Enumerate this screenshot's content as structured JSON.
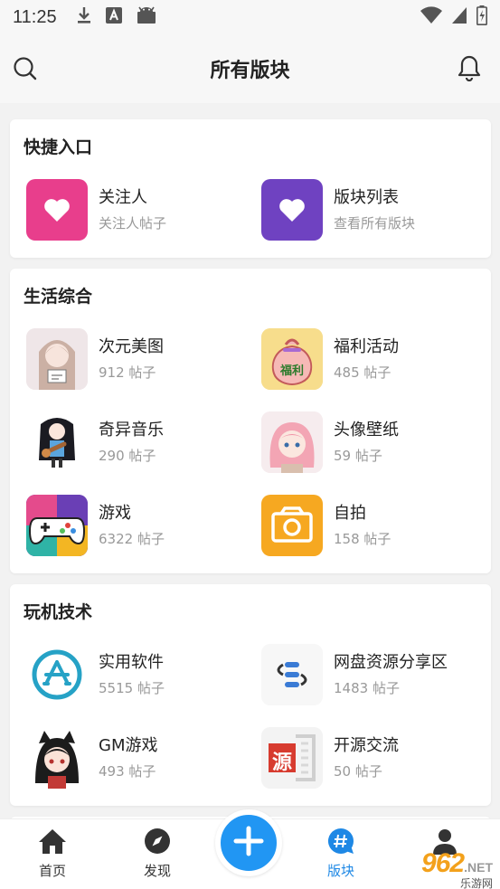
{
  "status_bar": {
    "time": "11:25"
  },
  "header": {
    "title": "所有版块"
  },
  "colors": {
    "accent": "#2196f3",
    "active_tab": "#1e88e5",
    "pink_tile": "#e83e8c",
    "purple_tile": "#6f42c1",
    "orange_tile": "#f6a821"
  },
  "sections": [
    {
      "title": "快捷入口",
      "items": [
        {
          "name": "关注人",
          "sub": "关注人帖子",
          "icon": "heart-icon"
        },
        {
          "name": "版块列表",
          "sub": "查看所有版块",
          "icon": "heart-icon"
        }
      ]
    },
    {
      "title": "生活综合",
      "items": [
        {
          "name": "次元美图",
          "sub": "912 帖子",
          "icon": "anime-girl-thumbnail"
        },
        {
          "name": "福利活动",
          "sub": "485 帖子",
          "icon": "money-bag-icon",
          "badge": "福利"
        },
        {
          "name": "奇异音乐",
          "sub": "290 帖子",
          "icon": "anime-guitar-thumbnail"
        },
        {
          "name": "头像壁纸",
          "sub": "59 帖子",
          "icon": "pink-hair-avatar-thumbnail"
        },
        {
          "name": "游戏",
          "sub": "6322 帖子",
          "icon": "gamepad-icon"
        },
        {
          "name": "自拍",
          "sub": "158 帖子",
          "icon": "camera-icon"
        }
      ]
    },
    {
      "title": "玩机技术",
      "items": [
        {
          "name": "实用软件",
          "sub": "5515 帖子",
          "icon": "app-store-icon"
        },
        {
          "name": "网盘资源分享区",
          "sub": "1483 帖子",
          "icon": "cloud-share-icon"
        },
        {
          "name": "GM游戏",
          "sub": "493 帖子",
          "icon": "cat-girl-thumbnail"
        },
        {
          "name": "开源交流",
          "sub": "50 帖子",
          "icon": "open-source-seal-icon",
          "badge": "源"
        }
      ]
    }
  ],
  "bottom_nav": [
    {
      "label": "首页",
      "icon": "home-icon"
    },
    {
      "label": "发现",
      "icon": "compass-icon"
    },
    {
      "label": "版块",
      "icon": "hashtag-chat-icon",
      "active": true
    },
    {
      "label": "",
      "icon": "profile-icon"
    }
  ],
  "watermark": {
    "big": "962",
    "net": ".NET",
    "small": "乐游网"
  }
}
